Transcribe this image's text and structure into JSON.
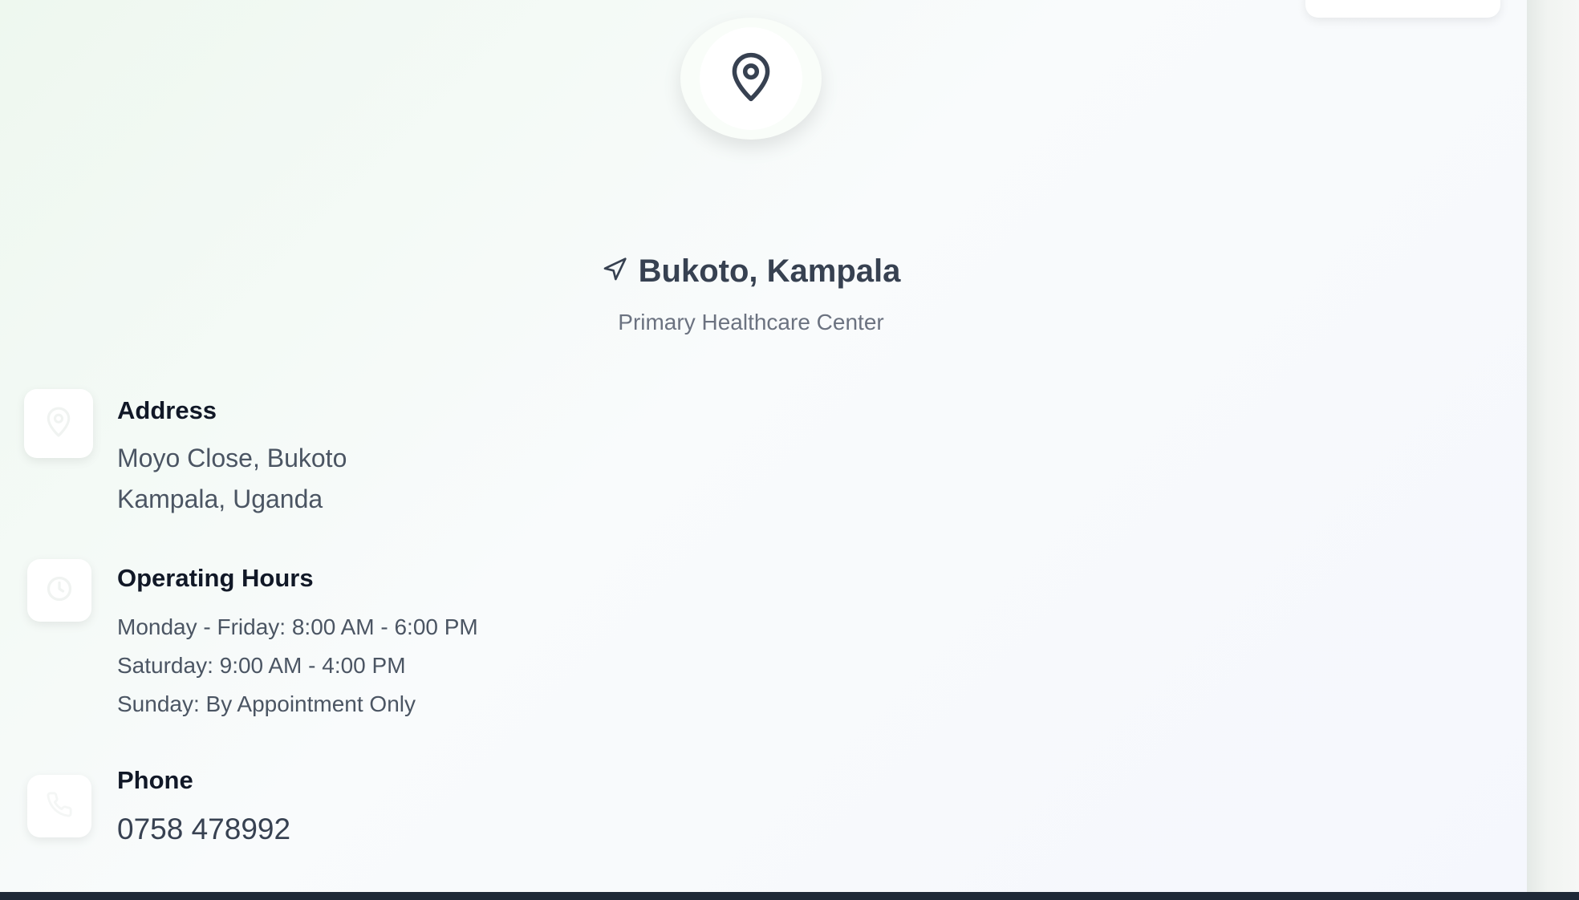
{
  "location": {
    "title": "Bukoto, Kampala",
    "subtitle": "Primary Healthcare Center"
  },
  "icons": {
    "main": "map-pin-icon",
    "title": "navigation-arrow-icon",
    "address": "map-pin-icon",
    "hours": "clock-icon",
    "phone": "phone-icon"
  },
  "address": {
    "label": "Address",
    "line1": "Moyo Close, Bukoto",
    "line2": "Kampala, Uganda"
  },
  "hours": {
    "label": "Operating Hours",
    "lines": [
      "Monday - Friday: 8:00 AM - 6:00 PM",
      "Saturday: 9:00 AM - 4:00 PM",
      "Sunday: By Appointment Only"
    ]
  },
  "phone": {
    "label": "Phone",
    "number": "0758 478992"
  },
  "colors": {
    "text_dark": "#111827",
    "text_body": "#4b5563",
    "text_muted": "#6b7280",
    "icon": "#374151"
  }
}
